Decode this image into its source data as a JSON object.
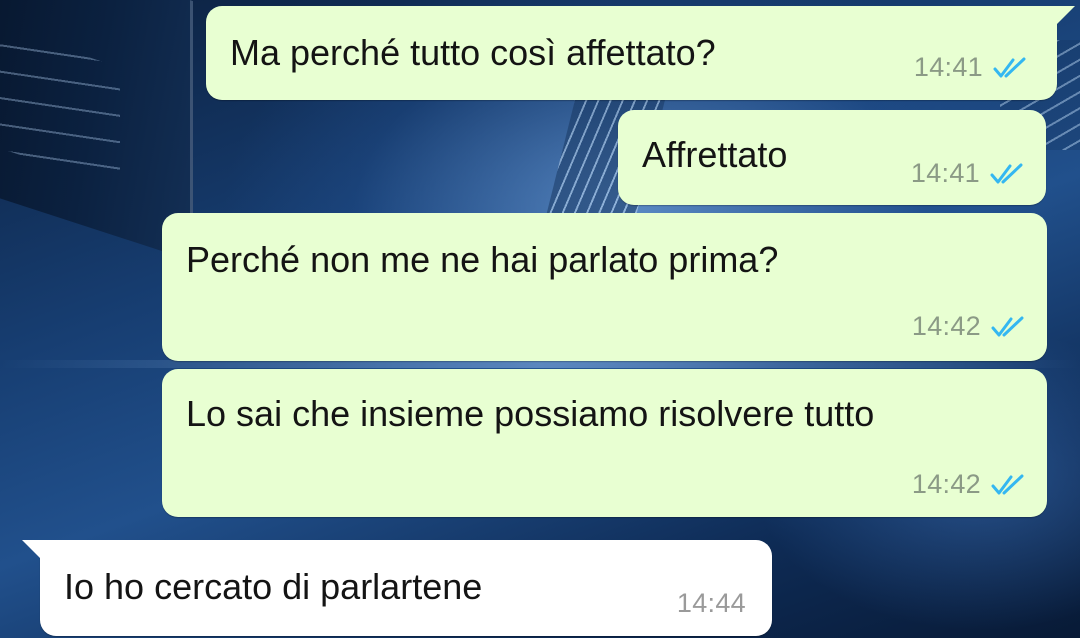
{
  "chat": {
    "messages": [
      {
        "direction": "out",
        "text": "Ma perché tutto così affettato?",
        "time": "14:41",
        "status": "double-check-read"
      },
      {
        "direction": "out",
        "text": "Affrettato",
        "time": "14:41",
        "status": "double-check-read"
      },
      {
        "direction": "out",
        "text": "Perché non me ne hai parlato prima?",
        "time": "14:42",
        "status": "double-check-read"
      },
      {
        "direction": "out",
        "text": "Lo sai che insieme possiamo risolvere tutto",
        "time": "14:42",
        "status": "double-check-read"
      },
      {
        "direction": "in",
        "text": "Io ho cercato di parlartene",
        "time": "14:44",
        "status": ""
      }
    ]
  },
  "colors": {
    "outgoing_bubble": "#e8ffd2",
    "incoming_bubble": "#ffffff",
    "read_ticks": "#34b7f1",
    "timestamp": "#8b9a86"
  }
}
